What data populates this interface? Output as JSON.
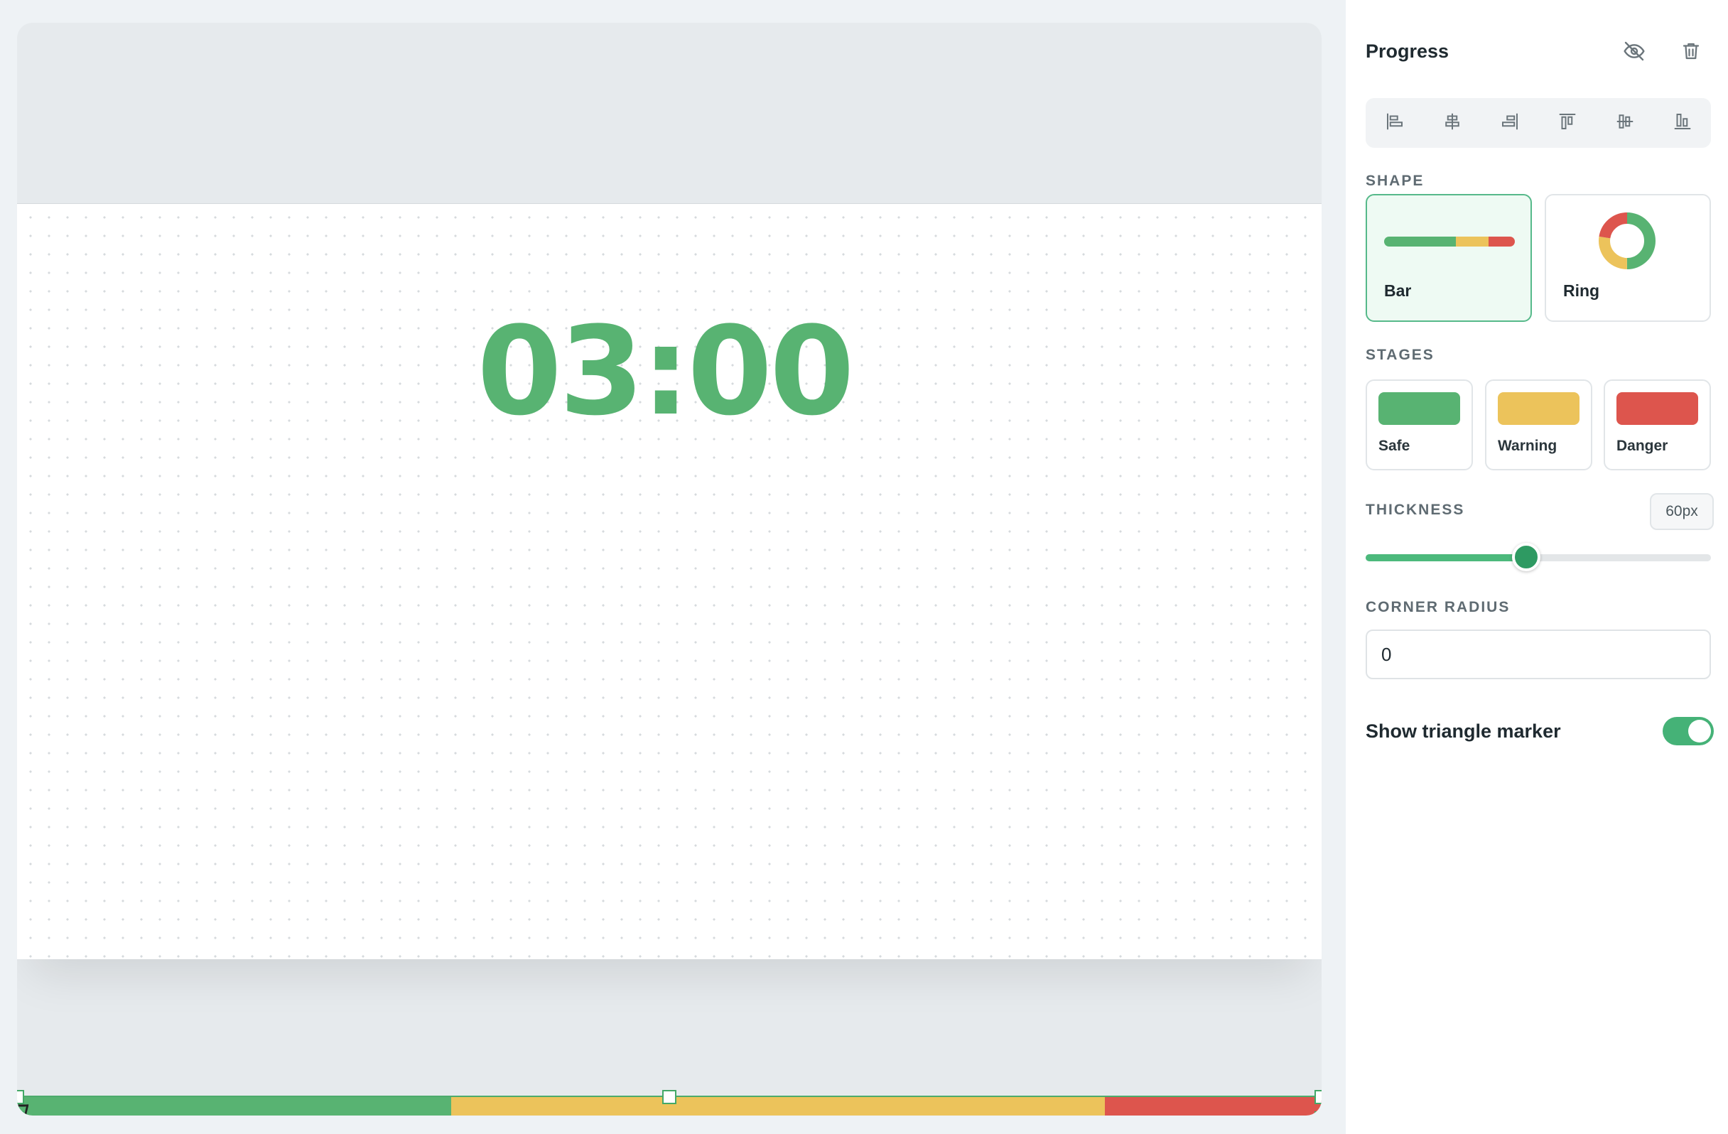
{
  "canvas": {
    "timer_text": "03:00",
    "progress": {
      "segments": [
        {
          "stage": "Safe",
          "color": "#58b372",
          "fraction": 0.333
        },
        {
          "stage": "Warning",
          "color": "#ecc35b",
          "fraction": 0.501
        },
        {
          "stage": "Danger",
          "color": "#dd554d",
          "fraction": 0.166
        }
      ]
    }
  },
  "panel": {
    "title": "Progress",
    "header_icons": [
      "eye-off-icon",
      "trash-icon"
    ],
    "align_tools": [
      "align-left-icon",
      "align-center-horizontal-icon",
      "align-right-icon",
      "align-top-icon",
      "align-center-vertical-icon",
      "align-bottom-icon"
    ],
    "shape": {
      "label": "SHAPE",
      "options": [
        {
          "label": "Bar",
          "selected": true
        },
        {
          "label": "Ring",
          "selected": false
        }
      ]
    },
    "stages": {
      "label": "STAGES",
      "items": [
        {
          "label": "Safe",
          "color": "#58b372"
        },
        {
          "label": "Warning",
          "color": "#ecc35b"
        },
        {
          "label": "Danger",
          "color": "#dd554d"
        }
      ]
    },
    "thickness": {
      "label": "THICKNESS",
      "value_text": "60px",
      "slider_fraction": 0.465
    },
    "corner_radius": {
      "label": "CORNER RADIUS",
      "value": "0"
    },
    "triangle_marker": {
      "label": "Show triangle marker",
      "enabled": true
    }
  },
  "colors": {
    "accent": "#45b277",
    "safe": "#58b372",
    "warning": "#ecc35b",
    "danger": "#dd554d"
  }
}
